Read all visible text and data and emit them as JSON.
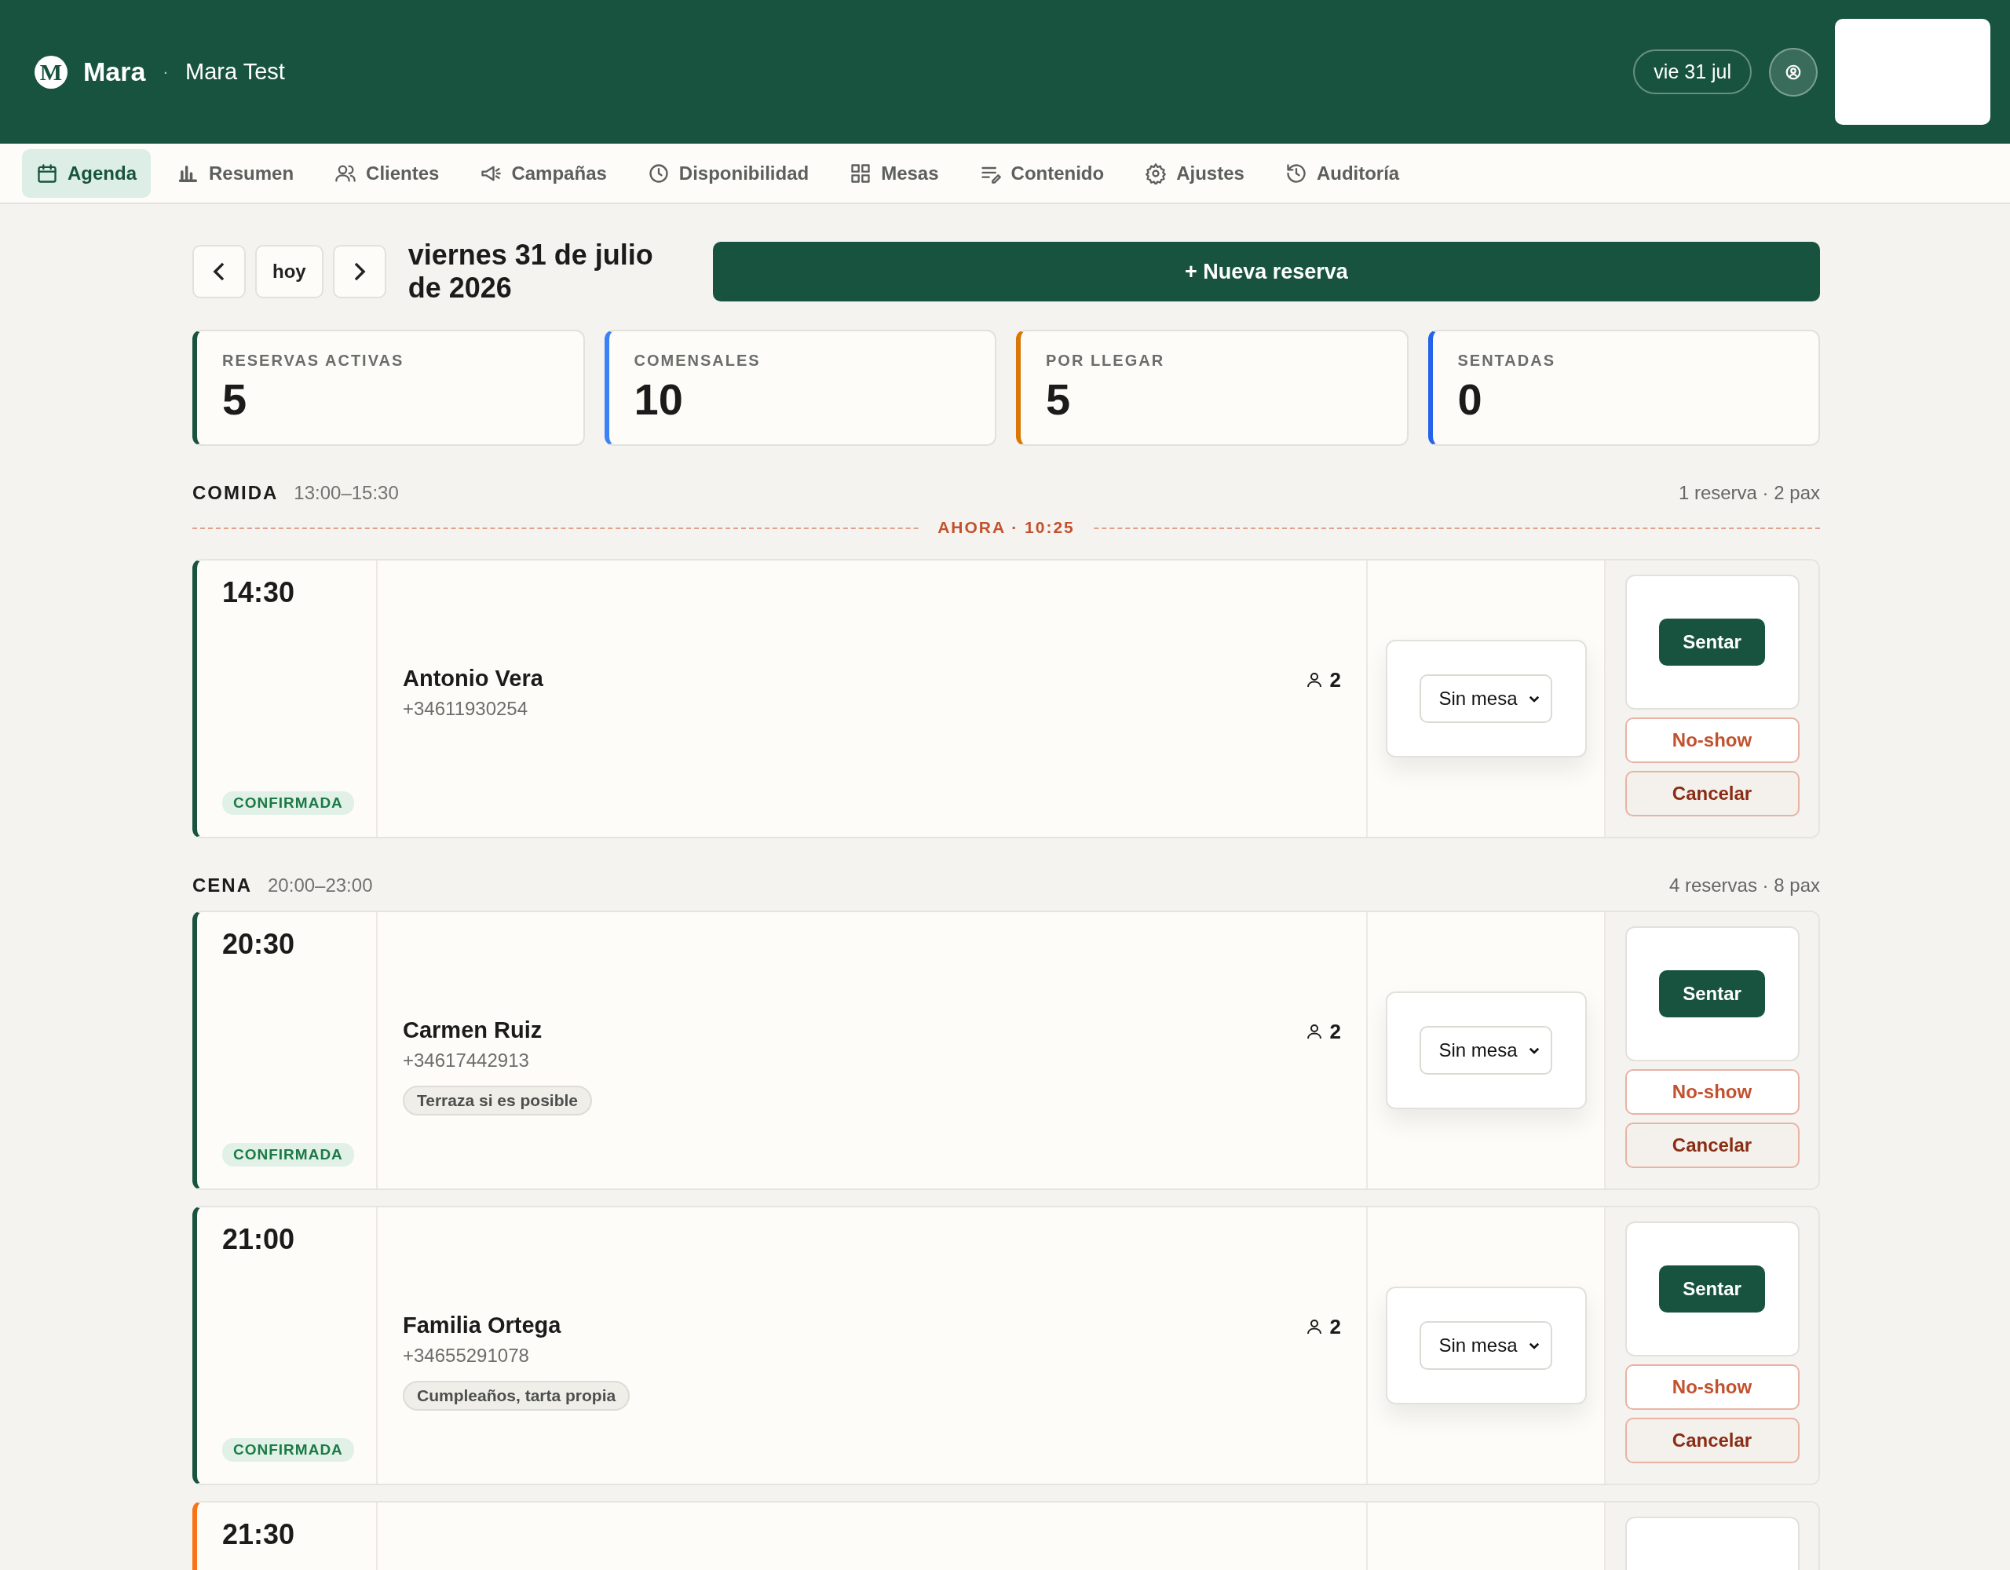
{
  "header": {
    "logo_letter": "M",
    "brand": "Mara",
    "separator": "·",
    "venue": "Mara Test",
    "date_pill": "vie 31 jul"
  },
  "tabs": [
    {
      "label": "Agenda",
      "selected": true
    },
    {
      "label": "Resumen",
      "selected": false
    },
    {
      "label": "Clientes",
      "selected": false
    },
    {
      "label": "Campañas",
      "selected": false
    },
    {
      "label": "Disponibilidad",
      "selected": false
    },
    {
      "label": "Mesas",
      "selected": false
    },
    {
      "label": "Contenido",
      "selected": false
    },
    {
      "label": "Ajustes",
      "selected": false
    },
    {
      "label": "Auditoría",
      "selected": false
    }
  ],
  "date_nav": {
    "today": "hoy",
    "title": "viernes 31 de julio de 2026",
    "new_button": "+ Nueva reserva"
  },
  "stats": [
    {
      "label": "RESERVAS ACTIVAS",
      "value": "5",
      "color": "#17533f"
    },
    {
      "label": "COMENSALES",
      "value": "10",
      "color": "#3b82f6"
    },
    {
      "label": "POR LLEGAR",
      "value": "5",
      "color": "#d97706"
    },
    {
      "label": "SENTADAS",
      "value": "0",
      "color": "#2563eb"
    }
  ],
  "sections": [
    {
      "name": "COMIDA",
      "hours": "13:00–15:30",
      "summary": "1 reserva · 2 pax",
      "now_marker": "AHORA · 10:25",
      "reservations": [
        {
          "time": "14:30",
          "color": "#17533f",
          "status": "CONFIRMADA",
          "name": "Antonio Vera",
          "phone": "+34611930254",
          "guests": "2",
          "table": "Sin mesa",
          "seat": "Sentar",
          "no_show": "No-show",
          "cancel": "Cancelar"
        }
      ]
    },
    {
      "name": "CENA",
      "hours": "20:00–23:00",
      "summary": "4 reservas · 8 pax",
      "reservations": [
        {
          "time": "20:30",
          "color": "#17533f",
          "status": "CONFIRMADA",
          "name": "Carmen Ruiz",
          "phone": "+34617442913",
          "note": "Terraza si es posible",
          "guests": "2",
          "table": "Sin mesa",
          "seat": "Sentar",
          "no_show": "No-show",
          "cancel": "Cancelar"
        },
        {
          "time": "21:00",
          "color": "#17533f",
          "status": "CONFIRMADA",
          "name": "Familia Ortega",
          "phone": "+34655291078",
          "note": "Cumpleaños, tarta propia",
          "guests": "2",
          "table": "Sin mesa",
          "seat": "Sentar",
          "no_show": "No-show",
          "cancel": "Cancelar"
        },
        {
          "time": "21:30",
          "color": "#f97316"
        }
      ]
    }
  ]
}
